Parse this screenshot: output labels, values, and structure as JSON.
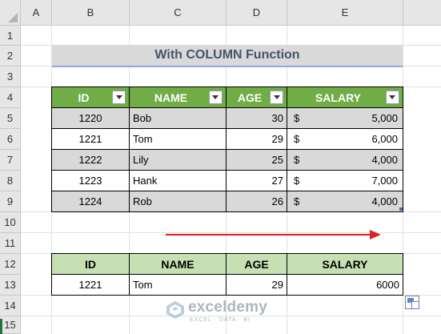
{
  "columns": [
    "A",
    "B",
    "C",
    "D",
    "E"
  ],
  "rows": [
    "1",
    "2",
    "3",
    "4",
    "5",
    "6",
    "7",
    "8",
    "9",
    "10",
    "11",
    "12",
    "13",
    "14",
    "15"
  ],
  "title": "With COLUMN Function",
  "table1": {
    "headers": [
      "ID",
      "NAME",
      "AGE",
      "SALARY"
    ],
    "rows": [
      {
        "id": "1220",
        "name": "Bob",
        "age": "30",
        "currency": "$",
        "salary": "5,000"
      },
      {
        "id": "1221",
        "name": "Tom",
        "age": "29",
        "currency": "$",
        "salary": "6,000"
      },
      {
        "id": "1222",
        "name": "Lily",
        "age": "25",
        "currency": "$",
        "salary": "4,000"
      },
      {
        "id": "1223",
        "name": "Hank",
        "age": "27",
        "currency": "$",
        "salary": "7,000"
      },
      {
        "id": "1224",
        "name": "Rob",
        "age": "26",
        "currency": "$",
        "salary": "4,000"
      }
    ]
  },
  "table2": {
    "headers": [
      "ID",
      "NAME",
      "AGE",
      "SALARY"
    ],
    "row": {
      "id": "1221",
      "name": "Tom",
      "age": "29",
      "salary": "6000"
    }
  },
  "watermark": {
    "brand": "exceldemy",
    "tagline": "EXCEL · DATA · BI"
  },
  "colors": {
    "header_green": "#70ad47",
    "light_green": "#c6e0b4",
    "arrow_red": "#e02020",
    "title_text": "#44546a"
  },
  "icons": {
    "filter": "dropdown-arrow-icon",
    "paste_options": "paste-options-icon",
    "arrow": "right-arrow-icon"
  }
}
